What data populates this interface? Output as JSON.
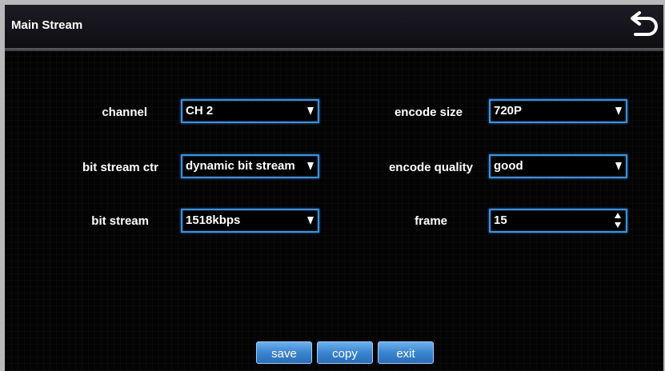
{
  "window": {
    "title": "Main Stream",
    "back_icon": "back-arrow-icon"
  },
  "form": {
    "channel": {
      "label": "channel",
      "value": "CH 2"
    },
    "bit_stream_ctr": {
      "label": "bit stream ctr",
      "value": "dynamic bit stream"
    },
    "bit_stream": {
      "label": "bit stream",
      "value": "1518kbps"
    },
    "encode_size": {
      "label": "encode size",
      "value": "720P"
    },
    "encode_quality": {
      "label": "encode quality",
      "value": "good"
    },
    "frame": {
      "label": "frame",
      "value": "15"
    }
  },
  "buttons": {
    "save": "save",
    "copy": "copy",
    "exit": "exit"
  },
  "colors": {
    "field_border": "#3f8fd6",
    "button": "#3b84cf",
    "background": "#030304"
  }
}
